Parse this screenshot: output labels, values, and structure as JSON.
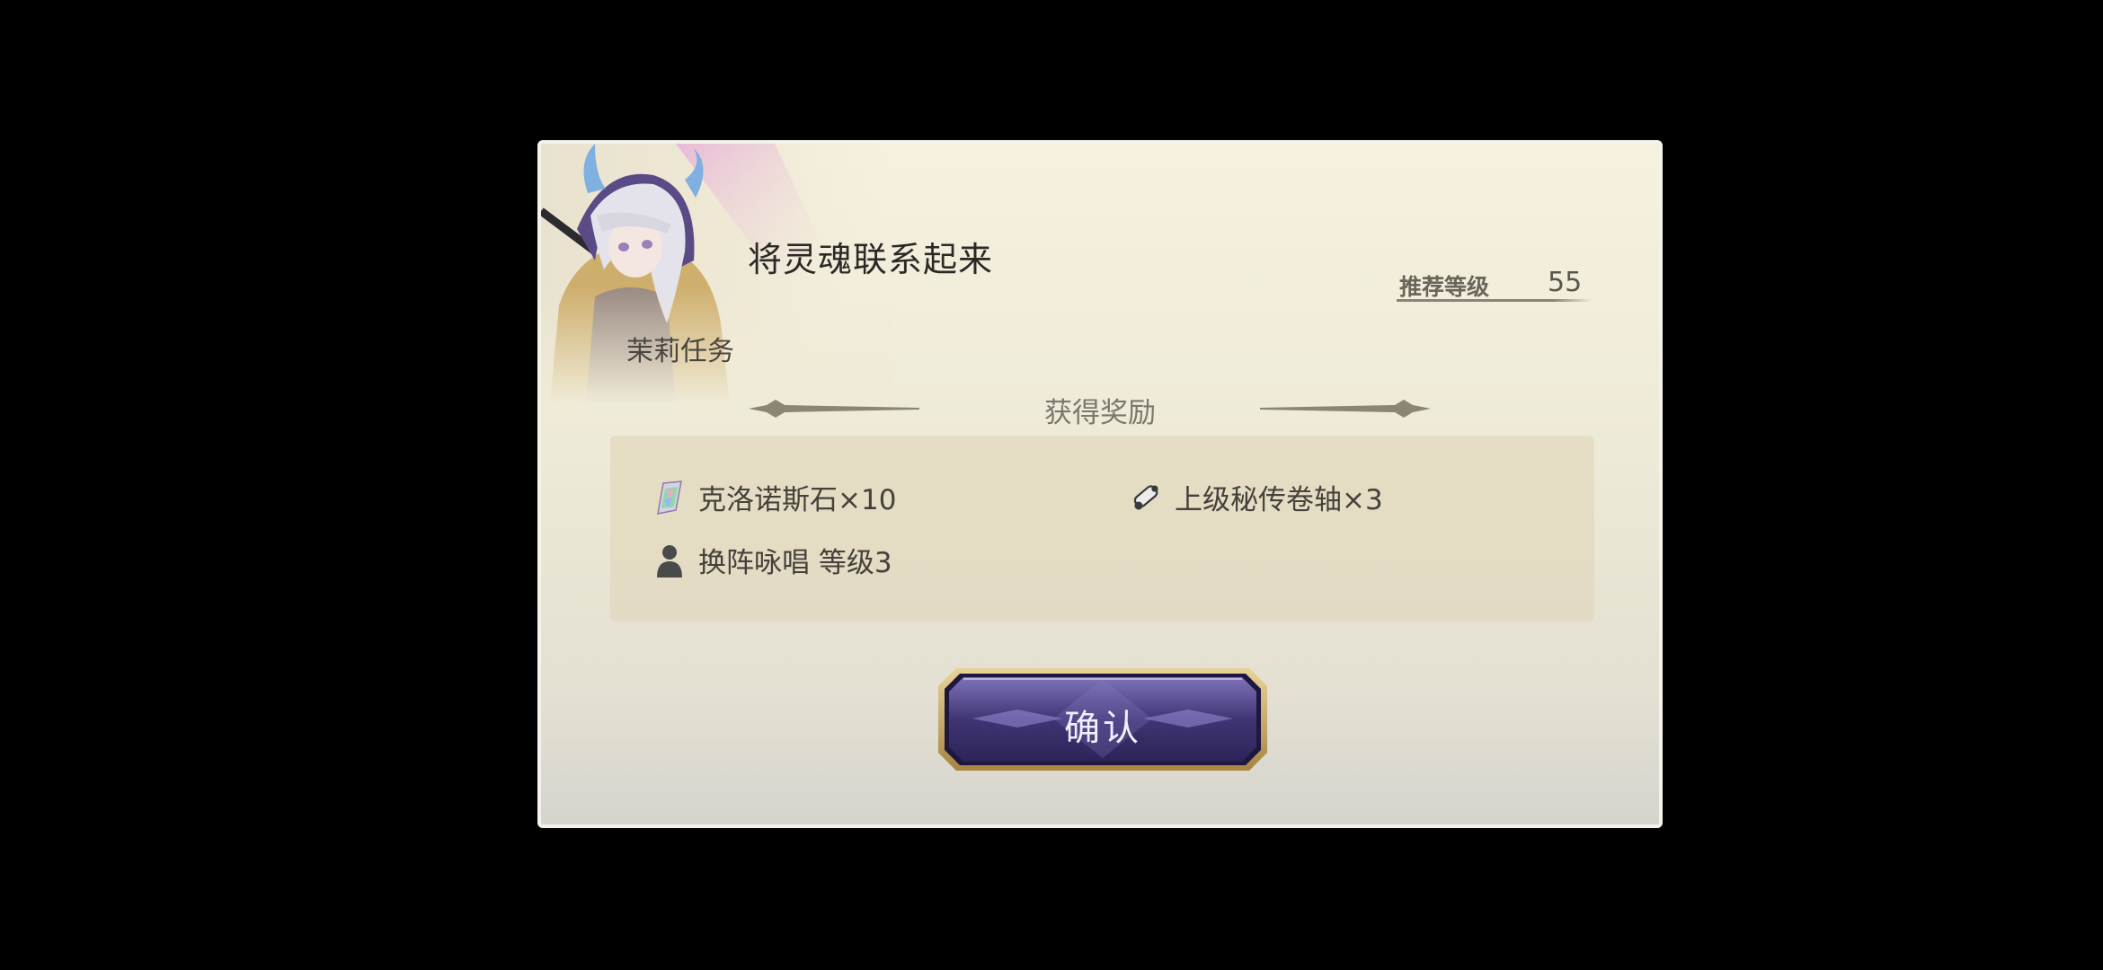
{
  "dialog": {
    "title": "将灵魂联系起来",
    "subtitle": "茉莉任务",
    "recommended_level_label": "推荐等级",
    "recommended_level_value": "55",
    "reward_heading": "获得奖励",
    "rewards": [
      {
        "icon": "crystal-stone-icon",
        "label": "克洛诺斯石×10"
      },
      {
        "icon": "scroll-icon",
        "label": "上级秘传卷轴×3"
      },
      {
        "icon": "person-icon",
        "label": "换阵咏唱 等级3"
      }
    ],
    "confirm_label": "确认"
  },
  "colors": {
    "dialog_bg": "#f2eddb",
    "reward_box_bg": "#e4dcc0",
    "button_purple": "#4a3f8c",
    "button_gold": "#c9a65a"
  }
}
